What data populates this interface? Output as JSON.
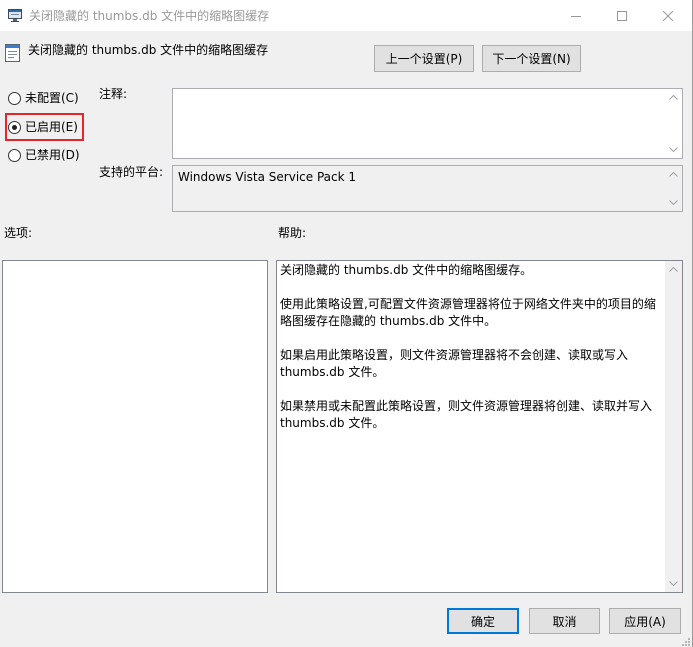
{
  "window": {
    "title": "关闭隐藏的 thumbs.db 文件中的缩略图缓存",
    "icon": "policy-window-icon",
    "controls": {
      "minimize": "minimize-icon",
      "maximize": "maximize-icon",
      "close": "close-icon"
    },
    "resize_grip": "resize-grip-icon"
  },
  "header": {
    "icon": "policy-setting-icon",
    "setting_name": "关闭隐藏的 thumbs.db 文件中的缩略图缓存",
    "previous_button": "上一个设置(P)",
    "next_button": "下一个设置(N)"
  },
  "state_options": [
    {
      "label": "未配置(C)",
      "selected": false,
      "highlighted": false
    },
    {
      "label": "已启用(E)",
      "selected": true,
      "highlighted": true
    },
    {
      "label": "已禁用(D)",
      "selected": false,
      "highlighted": false
    }
  ],
  "comment": {
    "label": "注释:",
    "value": ""
  },
  "supported_on": {
    "label": "支持的平台:",
    "value": "Windows Vista Service Pack 1"
  },
  "options_panel": {
    "label": "选项:"
  },
  "help_panel": {
    "label": "帮助:",
    "paragraphs": [
      "关闭隐藏的 thumbs.db 文件中的缩略图缓存。",
      "使用此策略设置,可配置文件资源管理器将位于网络文件夹中的项目的缩略图缓存在隐藏的 thumbs.db 文件中。",
      "如果启用此策略设置，则文件资源管理器将不会创建、读取或写入 thumbs.db 文件。",
      "如果禁用或未配置此策略设置，则文件资源管理器将创建、读取并写入 thumbs.db 文件。"
    ]
  },
  "footer": {
    "ok_button": "确定",
    "cancel_button": "取消",
    "apply_button": "应用(A)"
  },
  "scrollbar_icons": {
    "up": "scroll-up-icon",
    "down": "scroll-down-icon"
  },
  "colors": {
    "highlight_box": "#e3262a",
    "default_button_border": "#0078d7",
    "dialog_background": "#f0f0f0"
  }
}
